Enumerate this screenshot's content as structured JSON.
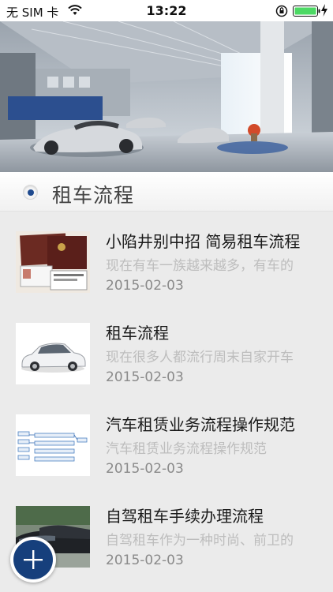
{
  "status_bar": {
    "carrier": "无 SIM 卡",
    "time": "13:22",
    "icons": [
      "wifi-icon",
      "rotation-lock-icon",
      "battery-icon",
      "charging-icon"
    ],
    "battery_color": "#4cd964"
  },
  "banner": {
    "description_icon": "car-showroom-photo"
  },
  "section": {
    "title": "租车流程",
    "accent_color": "#1f4a8e"
  },
  "articles": [
    {
      "title": "小陷井别中招 简易租车流程",
      "summary": "现在有车一族越来越多，有车的",
      "date": "2015-02-03",
      "thumb": "documents-photo"
    },
    {
      "title": "租车流程",
      "summary": "现在很多人都流行周末自家开车",
      "date": "2015-02-03",
      "thumb": "white-car-photo"
    },
    {
      "title": "汽车租赁业务流程操作规范",
      "summary": "汽车租赁业务流程操作规范",
      "date": "2015-02-03",
      "thumb": "flowchart-image"
    },
    {
      "title": "自驾租车手续办理流程",
      "summary": "自驾租车作为一种时尚、前卫的",
      "date": "2015-02-03",
      "thumb": "parked-cars-photo"
    }
  ],
  "fab": {
    "icon": "plus-icon",
    "color": "#163f7c"
  }
}
